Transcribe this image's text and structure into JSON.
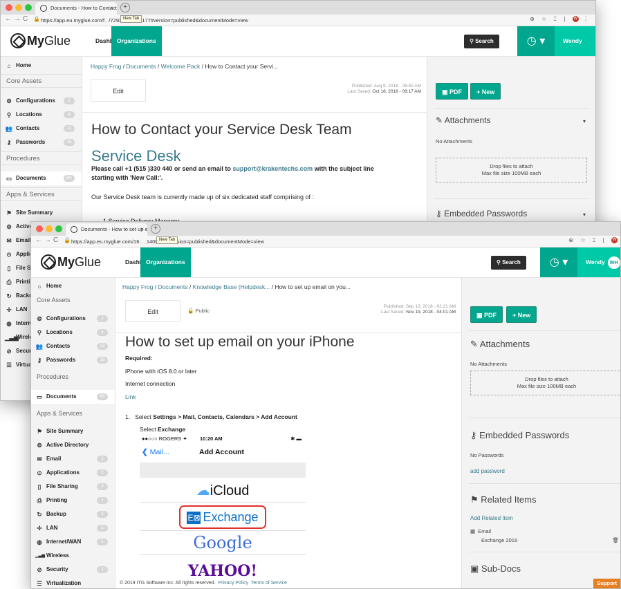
{
  "back_window": {
    "tab_title": "Documents - How to Contact y",
    "url": "https://app.eu.myglue.com/f",
    "url_suffix": "/72939224043177#version=published&documentMode=view",
    "tooltip": "New Tab",
    "avatar_letter": "W",
    "breadcrumb": {
      "items": [
        "Happy Frog",
        "Documents",
        "Welcome Pack"
      ],
      "current": "How to Contact your Servi...",
      "sep": "/"
    },
    "meta": {
      "published_label": "Published:",
      "published": "Aug 9, 2018 - 06:50 AM",
      "saved_label": "Last Saved:",
      "saved": "Oct 18, 2018 - 08:17 AM"
    },
    "title": "How to Contact your Service Desk Team",
    "heading": "Service Desk",
    "para1_prefix": "Please call +1 (515 )330 440 or send an email to ",
    "para1_link": "support@krakentechs.com",
    "para1_suffix": " with the subject line",
    "para1_line2": "starting with 'New Call:'.",
    "para2": "Our Service Desk team is currently made up of six dedicated staff comprising of :",
    "list_peek": "1 Service Delivery Manager",
    "right": {
      "attachments": "Attachments",
      "no_attachments": "No Attachments",
      "drop1": "Drop files to attach",
      "drop2": "Max file size 100MB each",
      "embedded_passwords": "Embedded Passwords"
    },
    "sidebar_cut": [
      "Active D",
      "Email",
      "Applicat",
      "File Sha",
      "Printing",
      "Backup",
      "LAN",
      "Internet",
      "Wireles",
      "Security",
      "Virtualiz"
    ]
  },
  "front_window": {
    "tab_title": "Documents - How to set up em",
    "url": "https://app.eu.myglue.com/16",
    "url_suffix": "1400410#version=published&documentMode=view",
    "tooltip": "New Tab",
    "avatar_letter": "W",
    "breadcrumb": {
      "items": [
        "Happy Frog",
        "Documents",
        "Knowledge Base (Helpdesk..."
      ],
      "current": "How to set up email on you...",
      "sep": "/"
    },
    "public_label": "Public",
    "meta": {
      "published_label": "Published:",
      "published": "Sep 13, 2018 - 02:21 AM",
      "saved_label": "Last Saved:",
      "saved": "Nov 19, 2018 - 04:01 AM"
    },
    "title": "How to set up email on your iPhone",
    "required": "Required:",
    "req1": "iPhone with iOS 8.0 or later",
    "req2": "Internet connection",
    "link": "Link",
    "step_num": "1.",
    "step_prefix": "Select ",
    "step_bold": "Settings > Mail, Contacts, Calendars > Add Account",
    "step2_prefix": "Select ",
    "step2_bold": "Exchange",
    "phone": {
      "carrier": "●●○○○ ROGERS ✦",
      "time": "10:20 AM",
      "back": "Mail...",
      "nav_title": "Add Account",
      "providers": [
        "iCloud",
        "Exchange",
        "Google",
        "YAHOO!"
      ]
    },
    "right": {
      "attachments": "Attachments",
      "no_attachments": "No Attachments",
      "drop1": "Drop files to attach",
      "drop2": "Max file size 100MB each",
      "embedded_passwords": "Embedded Passwords",
      "no_passwords": "No Passwords",
      "add_password": "add password",
      "related_items": "Related Items",
      "add_related": "Add Related Item",
      "related_type": "Email",
      "related_name": "Exchange 2016",
      "sub_docs": "Sub-Docs"
    },
    "footer": {
      "copyright": "© 2019 ITG Software Inc. All rights reserved.",
      "privacy": "Privacy Policy",
      "terms": "Terms of Service"
    },
    "support": "Support"
  },
  "header": {
    "logo_bold": "My",
    "logo_light": "Glue",
    "nav_dashboard": "Dashboard",
    "nav_organizations": "Organizations",
    "search": "Search",
    "user": "Wendy",
    "user_initials": "WH",
    "pdf": "PDF",
    "new": "+ New"
  },
  "sidebar": {
    "home": "Home",
    "core_assets": "Core Assets",
    "core": [
      {
        "label": "Configurations",
        "count": "1"
      },
      {
        "label": "Locations",
        "count": "4"
      },
      {
        "label": "Contacts",
        "count": "12"
      },
      {
        "label": "Passwords",
        "count": "15"
      }
    ],
    "procedures": "Procedures",
    "documents": {
      "label": "Documents",
      "count": "80"
    },
    "apps_services": "Apps & Services",
    "apps": [
      {
        "label": "Site Summary",
        "count": ""
      },
      {
        "label": "Active Directory",
        "count": ""
      },
      {
        "label": "Email",
        "count": "1"
      },
      {
        "label": "Applications",
        "count": "2"
      },
      {
        "label": "File Sharing",
        "count": "3"
      },
      {
        "label": "Printing",
        "count": "1"
      },
      {
        "label": "Backup",
        "count": "2"
      },
      {
        "label": "LAN",
        "count": "1"
      },
      {
        "label": "Internet/WAN",
        "count": "1"
      },
      {
        "label": "Wireless",
        "count": ""
      },
      {
        "label": "Security",
        "count": "1"
      },
      {
        "label": "Virtualization",
        "count": ""
      }
    ]
  },
  "colors": {
    "teal": "#00a78e",
    "teal_light": "#00c9a7",
    "link": "#3a7b8c",
    "support": "#e67e22",
    "exchange_blue": "#0b6ec7",
    "exchange_border": "#e0302a"
  }
}
